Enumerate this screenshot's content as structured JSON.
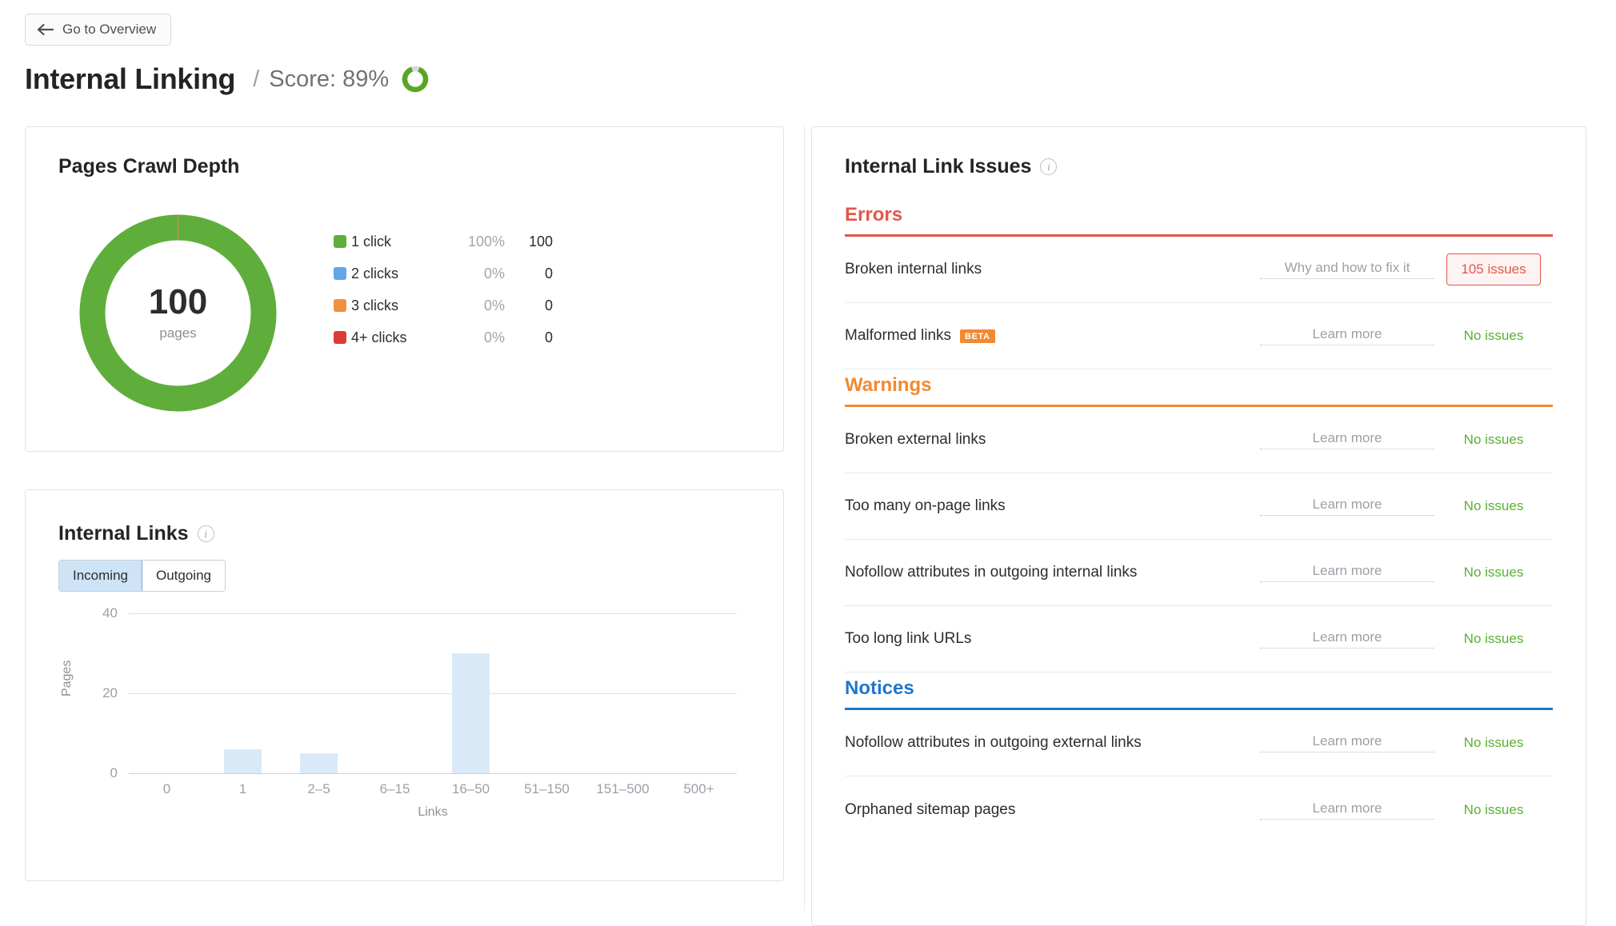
{
  "header": {
    "back_button": "Go to Overview",
    "back_icon": "arrow-left-icon",
    "title": "Internal Linking",
    "separator": "/",
    "score_label": "Score: 89%",
    "score_percent": 89,
    "score_ring_color": "#5ba524",
    "score_track_color": "#d8dadc"
  },
  "crawl_depth": {
    "title": "Pages Crawl Depth",
    "center_value": "100",
    "center_unit": "pages",
    "legend": [
      {
        "label": "1 click",
        "percent": "100%",
        "count": "100",
        "color": "#5fae3c"
      },
      {
        "label": "2 clicks",
        "percent": "0%",
        "count": "0",
        "color": "#5fa7e8"
      },
      {
        "label": "3 clicks",
        "percent": "0%",
        "count": "0",
        "color": "#ef9240"
      },
      {
        "label": "4+ clicks",
        "percent": "0%",
        "count": "0",
        "color": "#dc3c35"
      }
    ]
  },
  "internal_links": {
    "title": "Internal Links",
    "info_icon": "info-icon",
    "tabs": [
      {
        "label": "Incoming",
        "active": true
      },
      {
        "label": "Outgoing",
        "active": false
      }
    ]
  },
  "chart_data": {
    "type": "bar",
    "title": "Internal Links",
    "xlabel": "Links",
    "ylabel": "Pages",
    "categories": [
      "0",
      "1",
      "2–5",
      "6–15",
      "16–50",
      "51–150",
      "151–500",
      "500+"
    ],
    "values": [
      0,
      6,
      5,
      0,
      30,
      0,
      0,
      0
    ],
    "ylim": [
      0,
      40
    ],
    "yticks": [
      "0",
      "20",
      "40"
    ],
    "bar_color": "#d9e9f7",
    "grid": true,
    "legend": "none"
  },
  "issues": {
    "title": "Internal Link Issues",
    "info_icon": "info-icon",
    "groups": [
      {
        "name": "Errors",
        "color": "#e2574c",
        "rows": [
          {
            "name": "Broken internal links",
            "link": "Why and how to fix it",
            "badge": "105 issues",
            "status": null,
            "beta": false
          },
          {
            "name": "Malformed links",
            "link": "Learn more",
            "badge": null,
            "status": "No issues",
            "beta": true,
            "beta_label": "BETA"
          }
        ]
      },
      {
        "name": "Warnings",
        "color": "#f2892e",
        "rows": [
          {
            "name": "Broken external links",
            "link": "Learn more",
            "badge": null,
            "status": "No issues",
            "beta": false
          },
          {
            "name": "Too many on-page links",
            "link": "Learn more",
            "badge": null,
            "status": "No issues",
            "beta": false
          },
          {
            "name": "Nofollow attributes in outgoing internal links",
            "link": "Learn more",
            "badge": null,
            "status": "No issues",
            "beta": false
          },
          {
            "name": "Too long link URLs",
            "link": "Learn more",
            "badge": null,
            "status": "No issues",
            "beta": false
          }
        ]
      },
      {
        "name": "Notices",
        "color": "#1f76cb",
        "rows": [
          {
            "name": "Nofollow attributes in outgoing external links",
            "link": "Learn more",
            "badge": null,
            "status": "No issues",
            "beta": false
          },
          {
            "name": "Orphaned sitemap pages",
            "link": "Learn more",
            "badge": null,
            "status": "No issues",
            "beta": false
          }
        ]
      }
    ]
  }
}
